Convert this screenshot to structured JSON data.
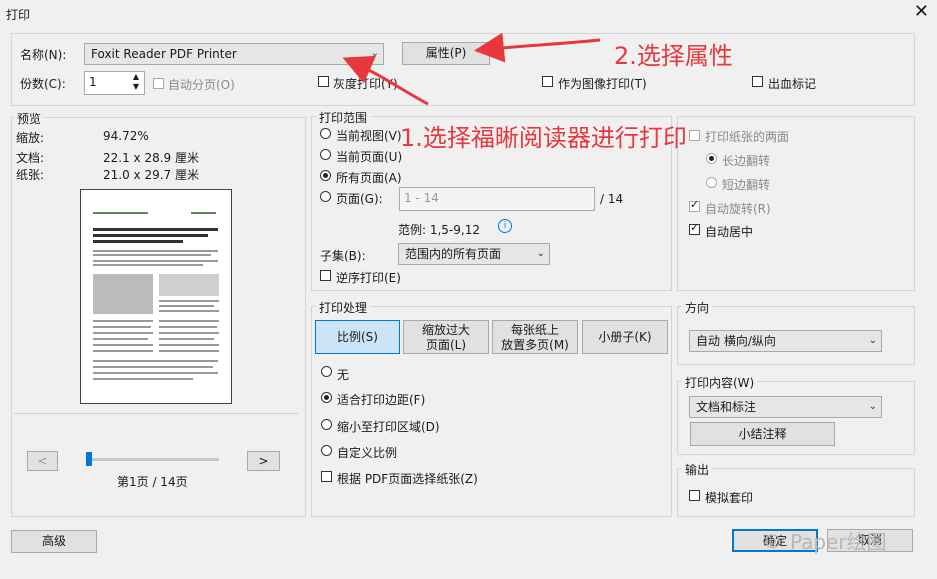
{
  "window": {
    "title": "打印"
  },
  "printer": {
    "name_label": "名称(N):",
    "name_value": "Foxit Reader PDF Printer",
    "properties_label": "属性(P)",
    "copies_label": "份数(C):",
    "copies_value": "1",
    "collate_label": "自动分页(O)",
    "grayscale_label": "灰度打印(Y)",
    "as_image_label": "作为图像打印(T)",
    "bleed_label": "出血标记"
  },
  "preview": {
    "group_label": "预览",
    "scale_label": "缩放:",
    "scale_value": "94.72%",
    "document_label": "文档:",
    "document_value": "22.1 x 28.9 厘米",
    "paper_label": "纸张:",
    "paper_value": "21.0 x 29.7 厘米",
    "prev_label": "<",
    "next_label": ">",
    "page_indicator": "第1页 / 14页"
  },
  "range": {
    "group_label": "打印范围",
    "current_view": "当前视图(V)",
    "current_page": "当前页面(U)",
    "all_pages": "所有页面(A)",
    "pages_label": "页面(G):",
    "pages_placeholder": "1 - 14",
    "pages_total": "/ 14",
    "example": "范例: 1,5-9,12",
    "subset_label": "子集(B):",
    "subset_value": "范围内的所有页面",
    "reverse_label": "逆序打印(E)"
  },
  "duplex": {
    "both_sides": "打印纸张的两面",
    "long_edge": "长边翻转",
    "short_edge": "短边翻转",
    "auto_rotate": "自动旋转(R)",
    "auto_center": "自动居中"
  },
  "handling": {
    "group_label": "打印处理",
    "tab_scale": "比例(S)",
    "tab_fit": "缩放过大\n页面(L)",
    "tab_multi": "每张纸上\n放置多页(M)",
    "tab_booklet": "小册子(K)",
    "opt_none": "无",
    "opt_fit_margins": "适合打印边距(F)",
    "opt_shrink": "缩小至打印区域(D)",
    "opt_custom": "自定义比例",
    "opt_paper_by_pdf": "根据 PDF页面选择纸张(Z)"
  },
  "orientation": {
    "group_label": "方向",
    "value": "自动 横向/纵向"
  },
  "content": {
    "group_label": "打印内容(W)",
    "value": "文档和标注",
    "summarize_label": "小结注释"
  },
  "output": {
    "group_label": "输出",
    "simulate_label": "模拟套印"
  },
  "footer": {
    "advanced_label": "高级",
    "ok_label": "确定",
    "cancel_label": "取消"
  },
  "annotations": {
    "step1": "1.选择福晰阅读器进行打印",
    "step2": "2.选择属性"
  },
  "watermark": {
    "text": "Paper绘图"
  },
  "colors": {
    "accent": "#0078d7",
    "annotation": "#e8383d"
  }
}
